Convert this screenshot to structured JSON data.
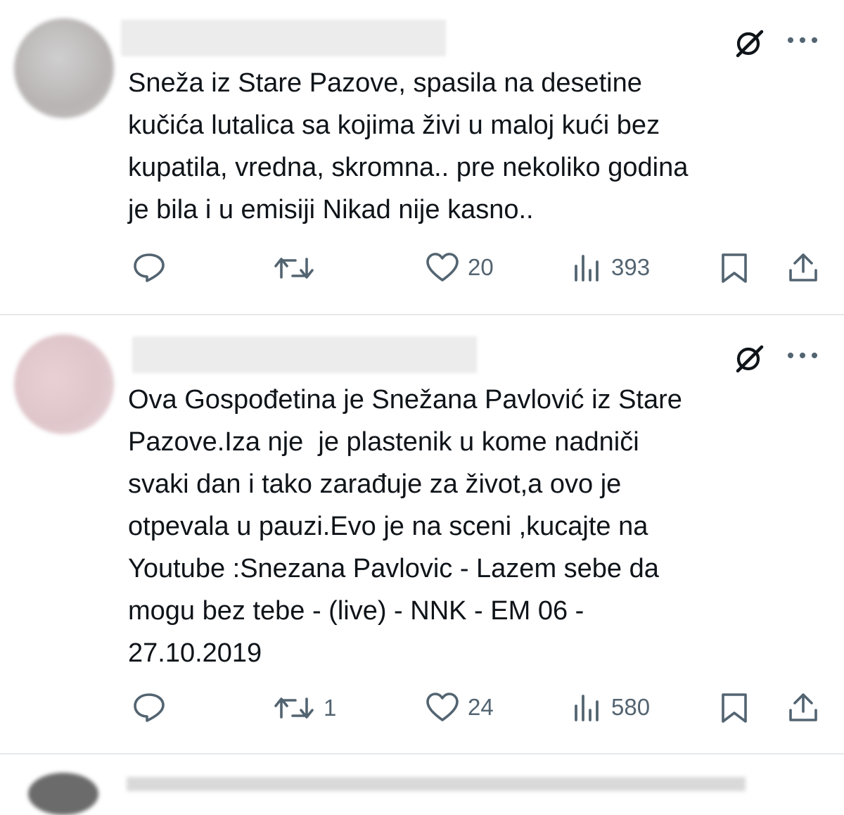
{
  "tweets": [
    {
      "text": "Sneža iz Stare Pazove, spasila na desetine\nkučića lutalica sa kojima živi u maloj kući bez\nkupatila, vredna, skromna.. pre nekoliko godina\nje bila i u emisiji Nikad nije kasno..",
      "actions": {
        "replies": "",
        "retweets": "",
        "likes": "20",
        "views": "393"
      }
    },
    {
      "text": "Ova Gospođetina je Snežana Pavlović iz Stare\nPazove.Iza nje  je plastenik u kome nadniči\nsvaki dan i tako zarađuje za život,a ovo je\notpevala u pauzi.Evo je na sceni ,kucajte na\nYoutube :Snezana Pavlovic - Lazem sebe da\nmogu bez tebe - (live) - NNK - EM 06 -\n27.10.2019",
      "actions": {
        "replies": "",
        "retweets": "1",
        "likes": "24",
        "views": "580"
      }
    }
  ],
  "icons": {
    "grok": "grok-icon",
    "more": "more-icon",
    "reply": "reply-icon",
    "retweet": "retweet-icon",
    "like": "like-icon",
    "views": "views-icon",
    "bookmark": "bookmark-icon",
    "share": "share-icon"
  },
  "colors": {
    "text": "#0f1419",
    "icon": "#536471",
    "divider": "#e6e9ec"
  }
}
